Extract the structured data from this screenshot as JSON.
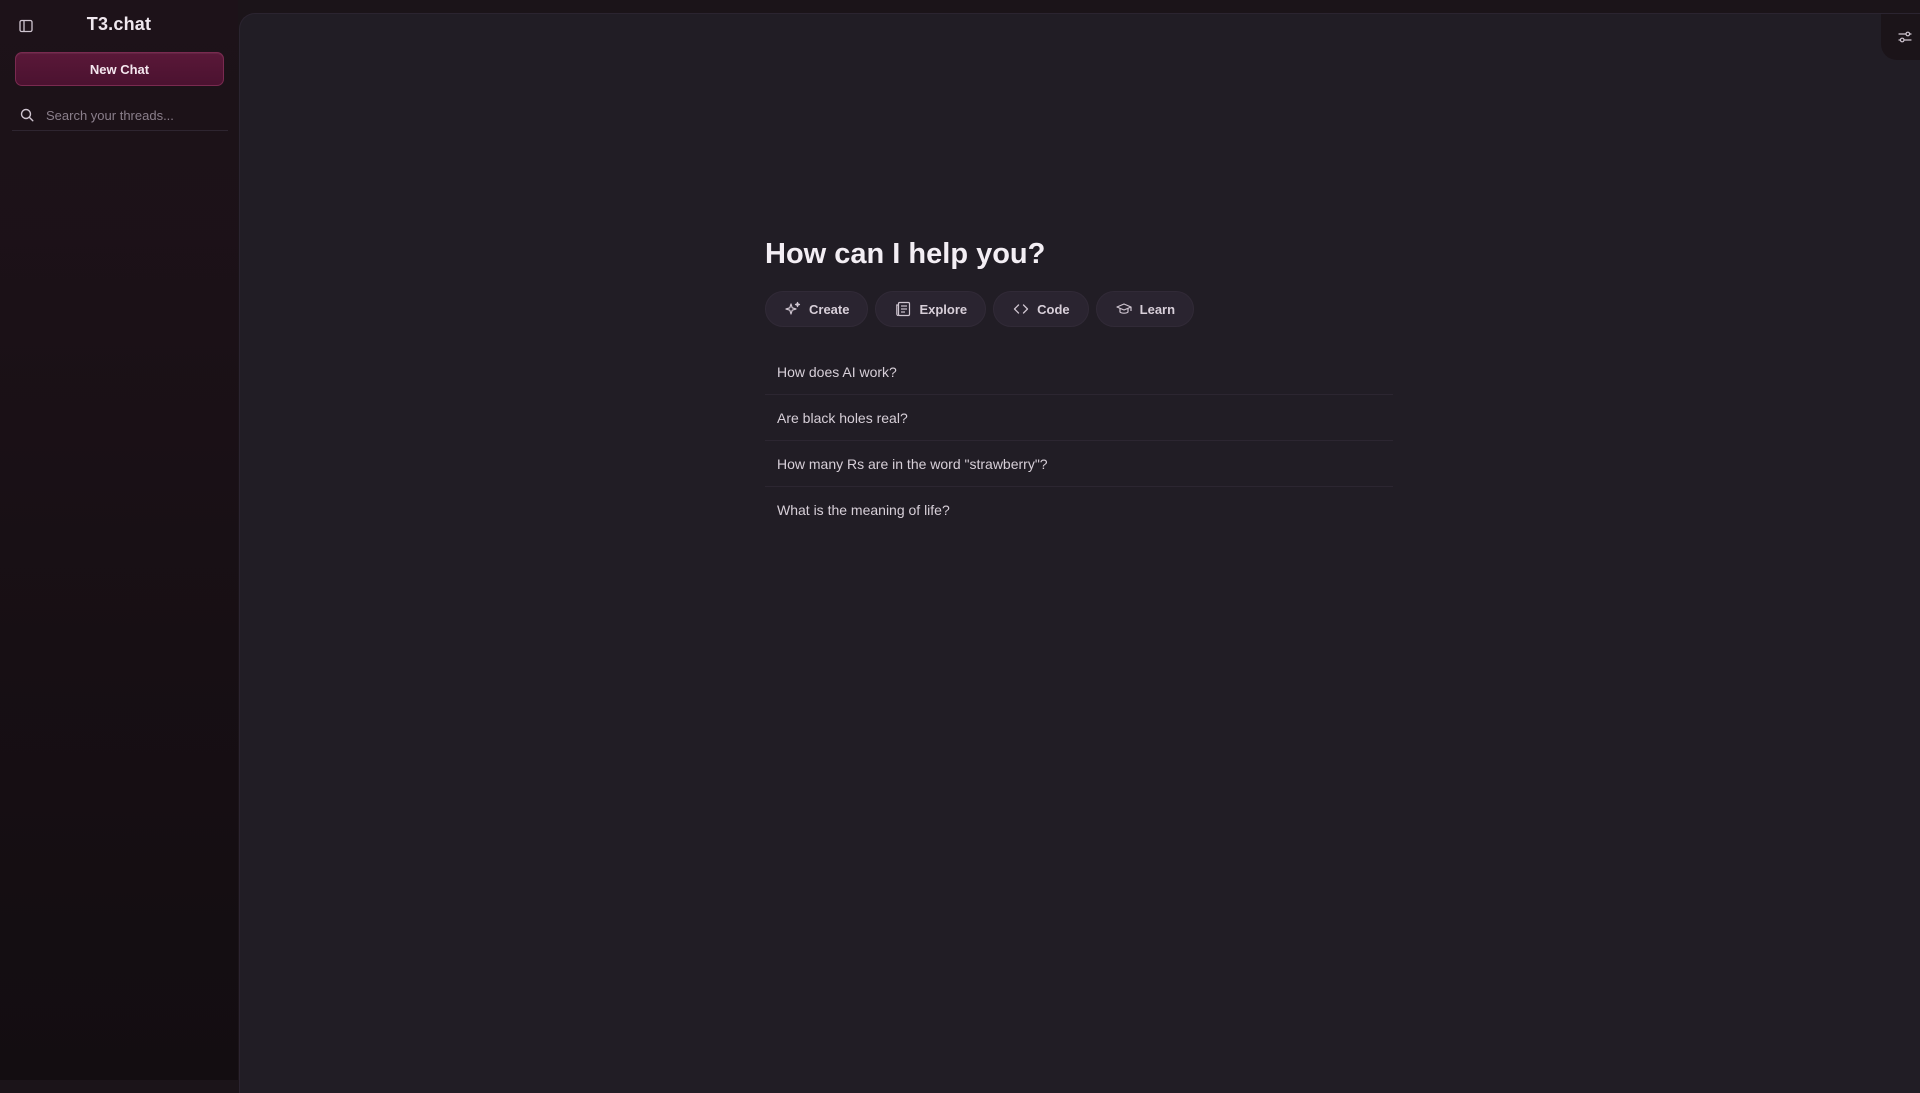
{
  "app": {
    "title": "T3.chat"
  },
  "sidebar": {
    "new_chat_label": "New Chat",
    "search": {
      "placeholder": "Search your threads...",
      "value": ""
    }
  },
  "main": {
    "headline": "How can I help you?",
    "actions": [
      {
        "label": "Create",
        "icon": "sparkles-icon"
      },
      {
        "label": "Explore",
        "icon": "newspaper-icon"
      },
      {
        "label": "Code",
        "icon": "code-icon"
      },
      {
        "label": "Learn",
        "icon": "graduation-cap-icon"
      }
    ],
    "suggestions": [
      "How does AI work?",
      "Are black holes real?",
      "How many Rs are in the word \"strawberry\"?",
      "What is the meaning of life?"
    ]
  },
  "colors": {
    "accent": "#5a1838",
    "background": "#211d25",
    "sidebar": "#1b1117"
  }
}
